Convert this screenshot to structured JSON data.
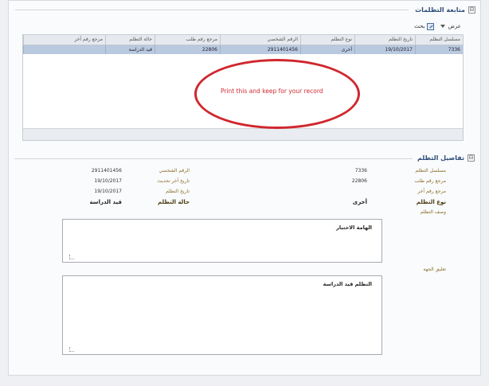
{
  "followup_section": {
    "title": "متابعة التظلمات",
    "toggle": "⊟"
  },
  "toolbar": {
    "dropdown_label": "عرض",
    "action_label": "بحث"
  },
  "grid": {
    "columns": [
      "مسلسل التظلم",
      "تاريخ التظلم",
      "نوع التظلم",
      "الرقم الشخصي",
      "مرجع رقم طلب",
      "حالة التظلم",
      "مرجع رقم آخر"
    ],
    "rows": [
      [
        "7336",
        "19/10/2017",
        "أخرى",
        "2911401456",
        "22806",
        "قيد الدراسة",
        ""
      ]
    ]
  },
  "annotation": {
    "text": "Print this and keep for your record"
  },
  "details_section": {
    "title": "تفاصيل التظلم",
    "toggle": "⊟",
    "right_labels": [
      "مسلسل التظلم",
      "مرجع رقم طلب",
      "مرجع رقم آخر",
      "نوع التظلم"
    ],
    "right_values": [
      "7336",
      "22806",
      "",
      "أخرى"
    ],
    "left_labels": [
      "الرقم الشخصي",
      "تاريخ آخر تحديث",
      "تاريخ التظلم",
      "حالة التظلم"
    ],
    "left_values": [
      "2911401456",
      "19/10/2017",
      "19/10/2017",
      "قيد الدراسة"
    ],
    "description_label": "وصف التظلم",
    "description_text": "الهامة الاختبار",
    "response_label": "تعليق الجهة",
    "response_text": "التظلم قيد الدراسة"
  }
}
